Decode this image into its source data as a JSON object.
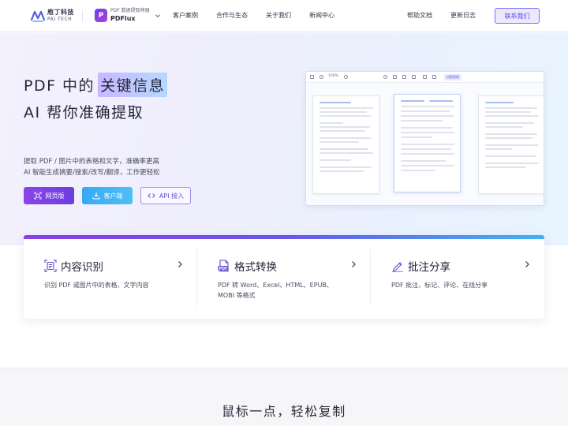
{
  "header": {
    "logo": {
      "name_cn": "庖丁科技",
      "name_en": "PAI TECH"
    },
    "product": {
      "tagline": "PDF 数据提取神器",
      "name": "PDFlux",
      "icon_letter": "P"
    },
    "nav": [
      {
        "label": "客户案例"
      },
      {
        "label": "合作与生态"
      },
      {
        "label": "关于我们"
      },
      {
        "label": "新闻中心"
      }
    ],
    "nav_right": [
      {
        "label": "帮助文档"
      },
      {
        "label": "更新日志"
      }
    ],
    "contact_label": "联系我们"
  },
  "hero": {
    "line1_prefix": "PDF 中的",
    "line1_highlight": "关键信息",
    "line2": "AI 帮你准确提取",
    "desc_line1": "提取 PDF / 图片中的表格和文字，准确率更高",
    "desc_line2": "AI 智能生成摘要/搜索/改写/翻译，工作更轻松",
    "buttons": {
      "web": "网页版",
      "client": "客户端",
      "api": "API 接入"
    },
    "preview": {
      "zoom": "100%",
      "chip": "切换表格"
    }
  },
  "features": [
    {
      "title": "内容识别",
      "icon": "document-scan-icon",
      "desc": [
        "识别 PDF 或图片中的表格、文字内容"
      ]
    },
    {
      "title": "格式转换",
      "icon": "pdf-file-icon",
      "desc": [
        "PDF 转 Word、Excel、HTML、EPUB、",
        "MOBI 等格式"
      ]
    },
    {
      "title": "批注分享",
      "icon": "pen-annotate-icon",
      "desc": [
        "PDF 批注、标记、评论、在线分享"
      ]
    }
  ],
  "section2": {
    "title": "鼠标一点，轻松复制"
  },
  "colors": {
    "accent_purple": "#6a3fe0",
    "accent_blue": "#37a8f5",
    "contact_border": "#7a6ef0"
  }
}
